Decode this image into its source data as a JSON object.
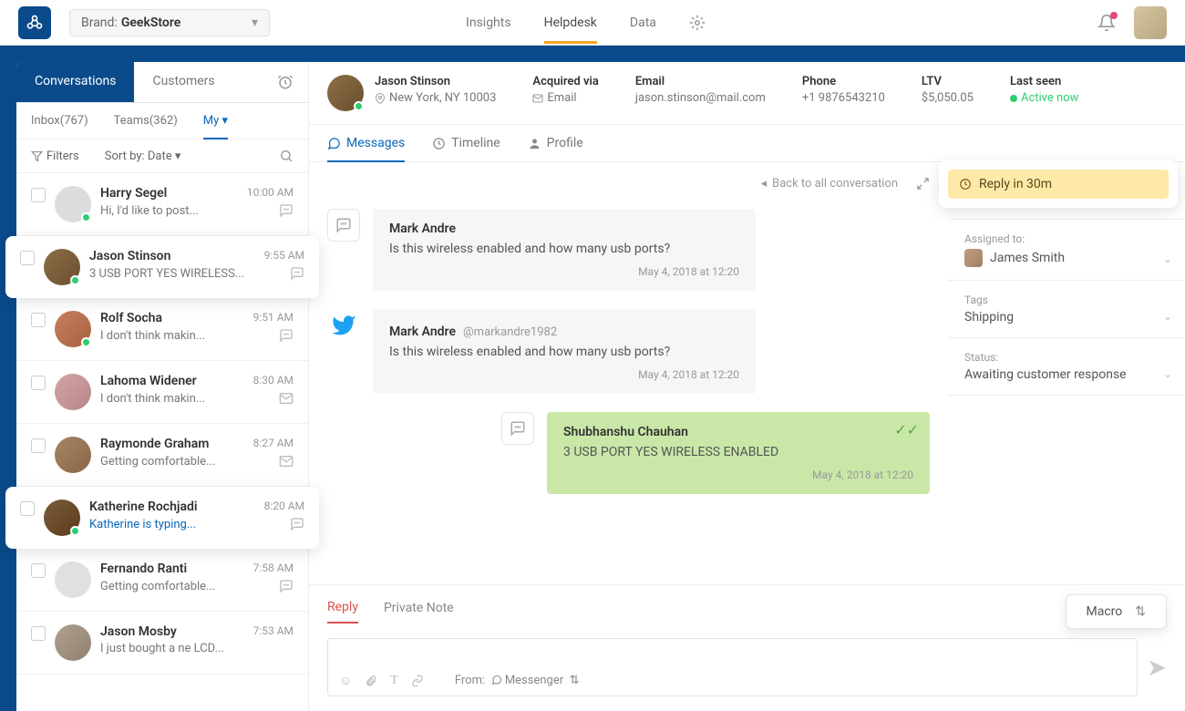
{
  "topbar": {
    "brand_prefix": "Brand:",
    "brand_name": "GeekStore",
    "nav": [
      "Insights",
      "Helpdesk",
      "Data"
    ]
  },
  "sidebar": {
    "tabs": [
      "Conversations",
      "Customers"
    ],
    "subtabs": {
      "inbox": "Inbox(767)",
      "teams": "Teams(362)",
      "my": "My"
    },
    "filters": "Filters",
    "sortby": "Sort by: Date",
    "items": [
      {
        "name": "Harry Segel",
        "time": "10:00 AM",
        "preview": "Hi, I'd like to post...",
        "chan": "chat",
        "presence": true,
        "av": "c1"
      },
      {
        "name": "Jason Stinson",
        "time": "9:55 AM",
        "preview": "3 USB PORT YES WIRELESS...",
        "chan": "chat",
        "presence": true,
        "av": "c2",
        "selected": true
      },
      {
        "name": "Rolf Socha",
        "time": "9:51 AM",
        "preview": "I don't think makin...",
        "chan": "chat",
        "presence": true,
        "av": "c3"
      },
      {
        "name": "Lahoma Widener",
        "time": "8:30 AM",
        "preview": "I don't think makin...",
        "chan": "mail",
        "presence": false,
        "av": "c4"
      },
      {
        "name": "Raymonde Graham",
        "time": "8:27 AM",
        "preview": "Getting comfortable...",
        "chan": "mail",
        "presence": false,
        "av": "c5"
      },
      {
        "name": "Katherine Rochjadi",
        "time": "8:20 AM",
        "preview": "Katherine is typing...",
        "chan": "chat",
        "presence": true,
        "av": "c6",
        "selected": true,
        "typing": true
      },
      {
        "name": "Fernando Ranti",
        "time": "7:58 AM",
        "preview": "Getting comfortable...",
        "chan": "chat",
        "presence": false,
        "av": "c7"
      },
      {
        "name": "Jason Mosby",
        "time": "7:53 AM",
        "preview": "I just bought a ne LCD...",
        "chan": "",
        "presence": false,
        "av": "c8"
      }
    ]
  },
  "customer": {
    "name": "Jason Stinson",
    "location": "New York, NY 10003",
    "acq_lbl": "Acquired via",
    "acq_val": "Email",
    "email_lbl": "Email",
    "email_val": "jason.stinson@mail.com",
    "phone_lbl": "Phone",
    "phone_val": "+1 9876543210",
    "ltv_lbl": "LTV",
    "ltv_val": "$5,050.05",
    "seen_lbl": "Last seen",
    "seen_val": "Active now",
    "dtabs": [
      "Messages",
      "Timeline",
      "Profile"
    ],
    "back": "Back to all conversation"
  },
  "messages": [
    {
      "kind": "chat",
      "name": "Mark Andre",
      "text": "Is this wireless enabled and how many usb ports?",
      "time": "May 4, 2018 at 12:20"
    },
    {
      "kind": "twitter",
      "name": "Mark Andre",
      "handle": "@markandre1982",
      "text": "Is this wireless enabled and how many usb ports?",
      "time": "May 4, 2018 at 12:20"
    },
    {
      "kind": "reply",
      "name": "Shubhanshu Chauhan",
      "text": "3 USB PORT YES WIRELESS ENABLED",
      "time": "May 4, 2018 at 12:20"
    }
  ],
  "rightpanel": {
    "reply_alert": "Reply in 30m",
    "assigned_lbl": "Assigned to:",
    "assigned_val": "James Smith",
    "tags_lbl": "Tags",
    "tags_val": "Shipping",
    "status_lbl": "Status:",
    "status_val": "Awaiting customer response"
  },
  "compose": {
    "reply": "Reply",
    "private": "Private Note",
    "macro": "Macro",
    "from_lbl": "From:",
    "from_val": "Messenger"
  }
}
